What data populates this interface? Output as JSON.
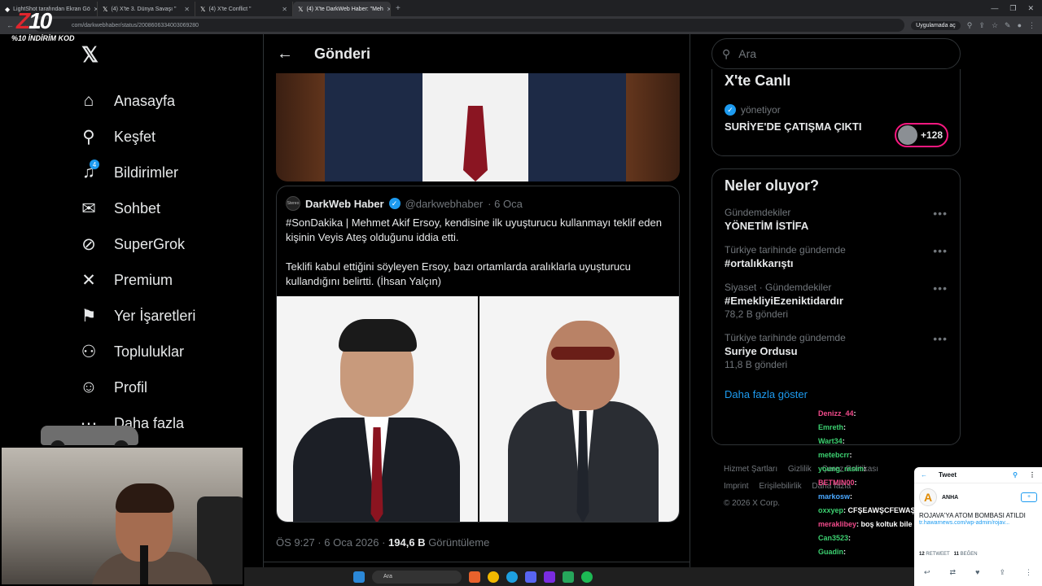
{
  "browser": {
    "tabs": [
      {
        "label": "LightShot tarafından Ekran Gö",
        "active": false
      },
      {
        "label": "(4) X'te 3. Dünya Savaşı \"",
        "active": false
      },
      {
        "label": "(4) X'te Conflict \"",
        "active": false
      },
      {
        "label": "(4) X'te DarkWeb Haber: \"Meh",
        "active": true
      }
    ],
    "url": "com/darkwebhaber/status/2008606334003069280",
    "app_button": "Uygulamada aç"
  },
  "overlay": {
    "logo": "Z",
    "logo_rest": "10",
    "promo": "%10 İNDİRİM KOD"
  },
  "nav": {
    "items": [
      {
        "icon": "home-icon",
        "glyph": "⌂",
        "label": "Anasayfa"
      },
      {
        "icon": "search-icon",
        "glyph": "⚲",
        "label": "Keşfet"
      },
      {
        "icon": "bell-icon",
        "glyph": "♫",
        "label": "Bildirimler",
        "badge": "4"
      },
      {
        "icon": "mail-icon",
        "glyph": "✉",
        "label": "Sohbet"
      },
      {
        "icon": "grok-icon",
        "glyph": "⊘",
        "label": "SuperGrok"
      },
      {
        "icon": "x-icon",
        "glyph": "✕",
        "label": "Premium"
      },
      {
        "icon": "bookmark-icon",
        "glyph": "⚑",
        "label": "Yer İşaretleri"
      },
      {
        "icon": "communities-icon",
        "glyph": "⚇",
        "label": "Topluluklar"
      },
      {
        "icon": "profile-icon",
        "glyph": "☺",
        "label": "Profil"
      },
      {
        "icon": "more-icon",
        "glyph": "⋯",
        "label": "Daha fazla"
      }
    ]
  },
  "header": {
    "title": "Gönderi"
  },
  "quote": {
    "avatar_text": "Stereo",
    "name": "DarkWeb Haber",
    "handle": "@darkwebhaber",
    "date": "· 6 Oca",
    "text": "#SonDakika | Mehmet Akif Ersoy, kendisine ilk uyuşturucu kullanmayı teklif eden kişinin Veyis Ateş olduğunu iddia etti.\n\nTeklifi kabul ettiğini söyleyen Ersoy, bazı ortamlarda aralıklarla uyuşturucu kullandığını belirtti. (İhsan Yalçın)"
  },
  "post_meta": {
    "time": "ÖS 9:27 · 6 Oca 2026 · ",
    "views": "194,6 B",
    "views_label": " Görüntüleme"
  },
  "search": {
    "placeholder": "Ara"
  },
  "live": {
    "title": "X'te Canlı",
    "host": "yönetiyor",
    "topic": "SURİYE'DE ÇATIŞMA ÇIKTI",
    "listeners": "+128"
  },
  "trends": {
    "title": "Neler oluyor?",
    "items": [
      {
        "context": "Gündemdekiler",
        "name": "YÖNETİM İSTİFA",
        "count": ""
      },
      {
        "context": "Türkiye tarihinde gündemde",
        "name": "#ortalıkkarıştı",
        "count": ""
      },
      {
        "context": "Siyaset · Gündemdekiler",
        "name": "#EmekliyiEzeniktidardır",
        "count": "78,2 B gönderi"
      },
      {
        "context": "Türkiye tarihinde gündemde",
        "name": "Suriye Ordusu",
        "count": "11,8 B gönderi"
      }
    ],
    "show_more": "Daha fazla göster"
  },
  "footer": {
    "links": [
      "Hizmet Şartları",
      "Gizlilik",
      "Çerez Politikası",
      "Imprint",
      "Erişilebilirlik",
      "Daha fazla"
    ],
    "copyright": "© 2026 X Corp."
  },
  "chat": [
    {
      "user": "Denizz_44",
      "msg": ": ",
      "style": "pink"
    },
    {
      "user": "Emreth",
      "msg": ": ",
      "style": "green"
    },
    {
      "user": "Wart34",
      "msg": ": ",
      "style": "green"
    },
    {
      "user": "metebcrr",
      "msg": ": ",
      "style": "green"
    },
    {
      "user": "young_rasim",
      "msg": ": ",
      "style": "green"
    },
    {
      "user": "BETMIN00",
      "msg": ": ",
      "style": "pink"
    },
    {
      "user": "markosw",
      "msg": ": ",
      "style": "blue"
    },
    {
      "user": "oxxyep",
      "msg": ": CFŞEAWŞCFEWAŞ",
      "style": "green"
    },
    {
      "user": "meraklibey",
      "msg": ": boş koltuk bile",
      "style": "pink"
    },
    {
      "user": "Can3523",
      "msg": ": ",
      "style": "green"
    },
    {
      "user": "Guadin",
      "msg": ": ",
      "style": "green"
    }
  ],
  "mobile_tweet": {
    "header": "Tweet",
    "avatar": "A",
    "name": "ANHA",
    "text": "ROJAVA'YA ATOM BOMBASI ATILDI",
    "link": "tr.hawarnews.com/wp-admin/rojav...",
    "retweets": "12",
    "retweets_label": "RETWEET",
    "likes": "11",
    "likes_label": "BEĞEN"
  },
  "taskbar": {
    "search": "Ara"
  }
}
